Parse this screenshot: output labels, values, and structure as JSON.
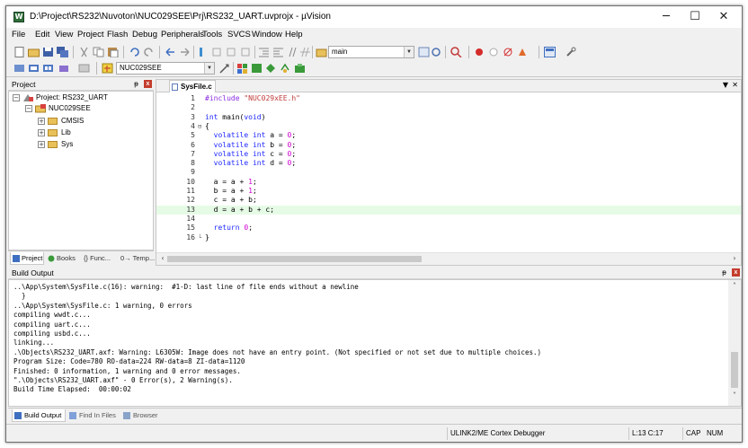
{
  "window": {
    "title": "D:\\Project\\RS232\\Nuvoton\\NUC029SEE\\Prj\\RS232_UART.uvprojx - µVision",
    "min_label": "─",
    "max_label": "☐",
    "close_label": "✕"
  },
  "menu": [
    "File",
    "Edit",
    "View",
    "Project",
    "Flash",
    "Debug",
    "Peripherals",
    "Tools",
    "SVCS",
    "Window",
    "Help"
  ],
  "toolbar": {
    "build_target_combo": "main",
    "target_combo": "NUC029SEE"
  },
  "project_pane": {
    "title": "Project",
    "pin": "ᵽ",
    "close": "x",
    "root": "Project: RS232_UART",
    "target": "NUC029SEE",
    "groups": [
      "CMSIS",
      "Lib",
      "Sys"
    ],
    "tabs": [
      "Project",
      "Books",
      "{} Func...",
      "0→ Temp..."
    ]
  },
  "editor": {
    "tab": "SysFile.c",
    "lines": [
      {
        "n": "1",
        "fold": "",
        "code": [
          {
            "t": "#include ",
            "c": "pp"
          },
          {
            "t": "\"NUC029xEE.h\"",
            "c": "str"
          }
        ]
      },
      {
        "n": "2",
        "fold": "",
        "code": []
      },
      {
        "n": "3",
        "fold": "",
        "code": [
          {
            "t": "int",
            "c": "kw"
          },
          {
            "t": " main(",
            "c": ""
          },
          {
            "t": "void",
            "c": "kw"
          },
          {
            "t": ")",
            "c": ""
          }
        ]
      },
      {
        "n": "4",
        "fold": "⊟",
        "code": [
          {
            "t": "{",
            "c": ""
          }
        ]
      },
      {
        "n": "5",
        "fold": "",
        "code": [
          {
            "t": "  ",
            "c": ""
          },
          {
            "t": "volatile int",
            "c": "kw"
          },
          {
            "t": " a = ",
            "c": ""
          },
          {
            "t": "0",
            "c": "num"
          },
          {
            "t": ";",
            "c": ""
          }
        ]
      },
      {
        "n": "6",
        "fold": "",
        "code": [
          {
            "t": "  ",
            "c": ""
          },
          {
            "t": "volatile int",
            "c": "kw"
          },
          {
            "t": " b = ",
            "c": ""
          },
          {
            "t": "0",
            "c": "num"
          },
          {
            "t": ";",
            "c": ""
          }
        ]
      },
      {
        "n": "7",
        "fold": "",
        "code": [
          {
            "t": "  ",
            "c": ""
          },
          {
            "t": "volatile int",
            "c": "kw"
          },
          {
            "t": " c = ",
            "c": ""
          },
          {
            "t": "0",
            "c": "num"
          },
          {
            "t": ";",
            "c": ""
          }
        ]
      },
      {
        "n": "8",
        "fold": "",
        "code": [
          {
            "t": "  ",
            "c": ""
          },
          {
            "t": "volatile int",
            "c": "kw"
          },
          {
            "t": " d = ",
            "c": ""
          },
          {
            "t": "0",
            "c": "num"
          },
          {
            "t": ";",
            "c": ""
          }
        ]
      },
      {
        "n": "9",
        "fold": "",
        "code": []
      },
      {
        "n": "10",
        "fold": "",
        "code": [
          {
            "t": "  a = a + ",
            "c": ""
          },
          {
            "t": "1",
            "c": "num"
          },
          {
            "t": ";",
            "c": ""
          }
        ]
      },
      {
        "n": "11",
        "fold": "",
        "code": [
          {
            "t": "  b = a + ",
            "c": ""
          },
          {
            "t": "1",
            "c": "num"
          },
          {
            "t": ";",
            "c": ""
          }
        ]
      },
      {
        "n": "12",
        "fold": "",
        "code": [
          {
            "t": "  c = a + b;",
            "c": ""
          }
        ]
      },
      {
        "n": "13",
        "fold": "",
        "code": [
          {
            "t": "  d = a + b + c;",
            "c": ""
          }
        ],
        "current": true
      },
      {
        "n": "14",
        "fold": "",
        "code": []
      },
      {
        "n": "15",
        "fold": "",
        "code": [
          {
            "t": "  ",
            "c": ""
          },
          {
            "t": "return",
            "c": "kw"
          },
          {
            "t": " ",
            "c": ""
          },
          {
            "t": "0",
            "c": "num"
          },
          {
            "t": ";",
            "c": ""
          }
        ]
      },
      {
        "n": "16",
        "fold": "└",
        "code": [
          {
            "t": "}",
            "c": ""
          }
        ]
      }
    ]
  },
  "build": {
    "title": "Build Output",
    "lines": [
      "..\\App\\System\\SysFile.c(16): warning:  #1-D: last line of file ends without a newline",
      "  }",
      "..\\App\\System\\SysFile.c: 1 warning, 0 errors",
      "compiling wwdt.c...",
      "compiling uart.c...",
      "compiling usbd.c...",
      "linking...",
      ".\\Objects\\RS232_UART.axf: Warning: L6305W: Image does not have an entry point. (Not specified or not set due to multiple choices.)",
      "Program Size: Code=780 RO-data=224 RW-data=8 ZI-data=1120",
      "Finished: 0 information, 1 warning and 0 error messages.",
      "\".\\Objects\\RS232_UART.axf\" - 0 Error(s), 2 Warning(s).",
      "Build Time Elapsed:  00:00:02"
    ],
    "tabs": [
      "Build Output",
      "Find In Files",
      "Browser"
    ]
  },
  "status": {
    "debugger": "ULINK2/ME Cortex Debugger",
    "position": "L:13 C:17",
    "caps": "CAP",
    "num": "NUM"
  },
  "colors": {
    "current_line": "#e6fbe6",
    "keyword": "#1f28ff",
    "string": "#c23a3a",
    "number": "#d000d0"
  }
}
